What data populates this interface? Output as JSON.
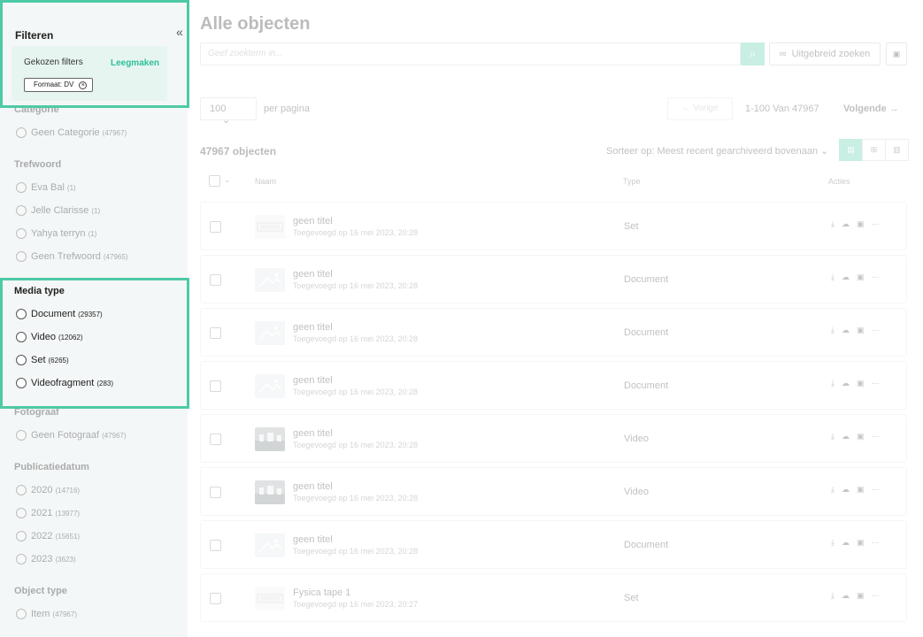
{
  "filters": {
    "title": "Filteren",
    "chosen_label": "Gekozen filters",
    "clear_label": "Leegmaken",
    "chips": [
      {
        "label": "Formaat: DV"
      }
    ]
  },
  "sections": {
    "category": {
      "title": "Categorie",
      "options": [
        {
          "label": "Geen Categorie",
          "count": "(47967)"
        }
      ]
    },
    "keyword": {
      "title": "Trefwoord",
      "options": [
        {
          "label": "Eva Bal",
          "count": "(1)"
        },
        {
          "label": "Jelle Clarisse",
          "count": "(1)"
        },
        {
          "label": "Yahya terryn",
          "count": "(1)"
        },
        {
          "label": "Geen Trefwoord",
          "count": "(47965)"
        }
      ]
    },
    "media_type": {
      "title": "Media type",
      "options": [
        {
          "label": "Document",
          "count": "(29357)"
        },
        {
          "label": "Video",
          "count": "(12062)"
        },
        {
          "label": "Set",
          "count": "(6265)"
        },
        {
          "label": "Videofragment",
          "count": "(283)"
        }
      ]
    },
    "photographer": {
      "title": "Fotograaf",
      "options": [
        {
          "label": "Geen Fotograaf",
          "count": "(47967)"
        }
      ]
    },
    "pubdate": {
      "title": "Publicatiedatum",
      "options": [
        {
          "label": "2020",
          "count": "(14716)"
        },
        {
          "label": "2021",
          "count": "(13977)"
        },
        {
          "label": "2022",
          "count": "(15651)"
        },
        {
          "label": "2023",
          "count": "(3623)"
        }
      ]
    },
    "object_type": {
      "title": "Object type",
      "options": [
        {
          "label": "Item",
          "count": "(47967)"
        }
      ]
    }
  },
  "main": {
    "title": "Alle objecten",
    "search_placeholder": "Geef zoekterm in...",
    "advanced_search_label": "Uitgebreid zoeken",
    "per_page_value": "100",
    "per_page_label": "per pagina",
    "prev_label": "← Vorige",
    "range_text": "1-100 Van 47967",
    "next_label": "Volgende →",
    "object_count": "47967 objecten",
    "sort_text": "Sorteer op: Meest recent gearchiveerd bovenaan",
    "columns": {
      "name": "Naam",
      "type": "Type",
      "actions": "Acties"
    }
  },
  "rows": [
    {
      "title": "geen titel",
      "date": "Toegevoegd op 16 mei 2023, 20:28",
      "type": "Set",
      "thumb": "set"
    },
    {
      "title": "geen titel",
      "date": "Toegevoegd op 16 mei 2023, 20:28",
      "type": "Document",
      "thumb": "placeholder"
    },
    {
      "title": "geen titel",
      "date": "Toegevoegd op 16 mei 2023, 20:28",
      "type": "Document",
      "thumb": "placeholder"
    },
    {
      "title": "geen titel",
      "date": "Toegevoegd op 16 mei 2023, 20:28",
      "type": "Document",
      "thumb": "placeholder"
    },
    {
      "title": "geen titel",
      "date": "Toegevoegd op 16 mei 2023, 20:28",
      "type": "Video",
      "thumb": "video"
    },
    {
      "title": "geen titel",
      "date": "Toegevoegd op 16 mei 2023, 20:28",
      "type": "Video",
      "thumb": "video"
    },
    {
      "title": "geen titel",
      "date": "Toegevoegd op 16 mei 2023, 20:28",
      "type": "Document",
      "thumb": "placeholder"
    },
    {
      "title": "Fysica tape 1",
      "date": "Toegevoegd op 16 mei 2023, 20:27",
      "type": "Set",
      "thumb": "set"
    }
  ],
  "colors": {
    "accent": "#4ec9a6",
    "highlight_border": "#4ec9a6"
  }
}
